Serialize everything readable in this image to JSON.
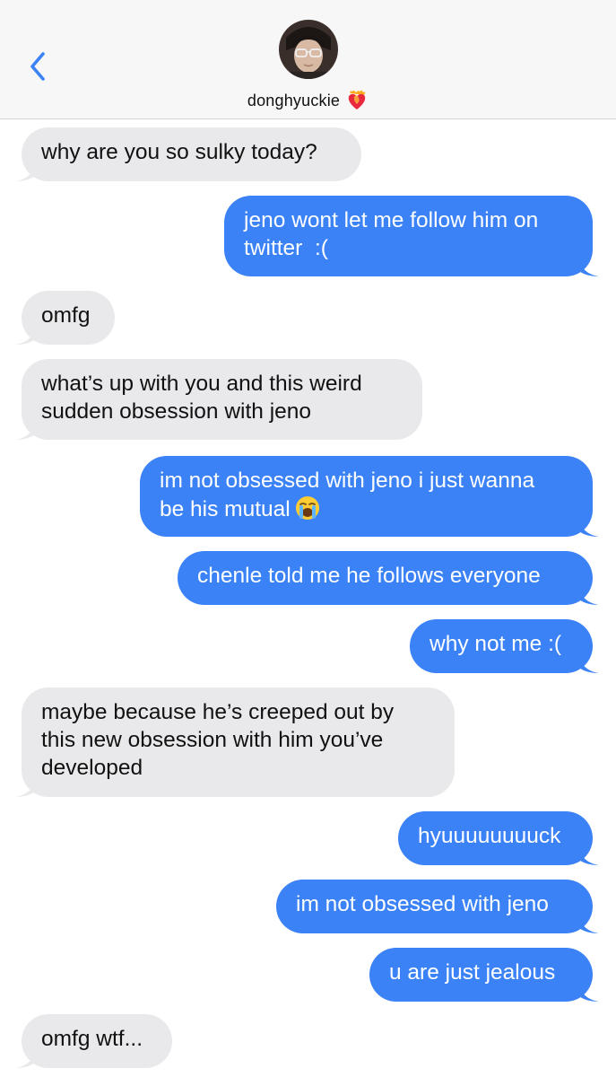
{
  "header": {
    "back_icon": "chevron-left-icon",
    "contact_name": "donghyuckie",
    "contact_emoji": "heart-on-fire-emoji",
    "accent_color": "#3a82f6"
  },
  "messages": [
    {
      "from": "them",
      "text": "why are you so sulky today?"
    },
    {
      "from": "me",
      "text": "jeno wont let me follow him on\ntwitter  :("
    },
    {
      "from": "them",
      "text": "omfg"
    },
    {
      "from": "them",
      "text": "what’s up with you and this weird\nsudden obsession with jeno"
    },
    {
      "from": "me",
      "text": "im not obsessed with jeno i just wanna\nbe his mutual",
      "emoji": "loudly-crying-face-emoji"
    },
    {
      "from": "me",
      "text": "chenle told me he follows everyone"
    },
    {
      "from": "me",
      "text": "why not me :("
    },
    {
      "from": "them",
      "text": "maybe because he’s creeped out by\nthis new obsession with him you’ve\ndeveloped"
    },
    {
      "from": "me",
      "text": "hyuuuuuuuuck"
    },
    {
      "from": "me",
      "text": "im not obsessed with jeno"
    },
    {
      "from": "me",
      "text": "u are just jealous"
    },
    {
      "from": "them",
      "text": "omfg wtf..."
    }
  ],
  "colors": {
    "incoming_bubble": "#e9e9eb",
    "outgoing_bubble": "#3a82f6",
    "header_bg": "#f7f7f7"
  }
}
